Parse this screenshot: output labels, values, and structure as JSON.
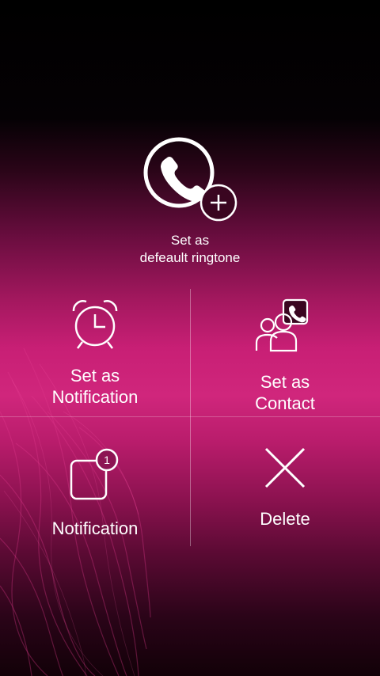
{
  "default_ringtone": {
    "line1": "Set as",
    "line2": "defeault ringtone",
    "icon": "phone-plus-icon"
  },
  "options": [
    {
      "line1": "Set as",
      "line2": "Notification",
      "icon": "alarm-clock-icon"
    },
    {
      "line1": "Set as",
      "line2": "Contact",
      "icon": "contacts-icon"
    },
    {
      "label": "Notification",
      "badge": "1",
      "icon": "notification-badge-icon"
    },
    {
      "label": "Delete",
      "icon": "close-x-icon"
    }
  ],
  "colors": {
    "accent": "#d0267c",
    "background_top": "#000000"
  }
}
